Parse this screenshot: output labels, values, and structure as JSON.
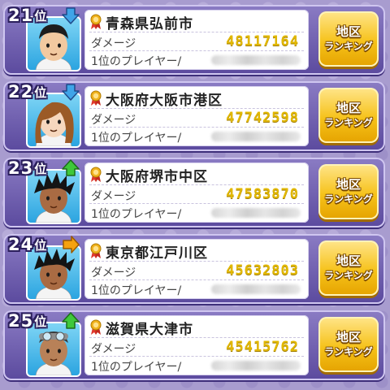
{
  "rank_suffix": "位",
  "damage_label": "ダメージ",
  "player_label": "1位のプレイヤー/",
  "button": {
    "line1": "地区",
    "line2": "ランキング"
  },
  "trend_colors": {
    "down": "#3fa4e8",
    "up": "#3ec83a",
    "flat": "#f5a20f"
  },
  "rows": [
    {
      "rank": "21",
      "trend": "down",
      "region": "青森県弘前市",
      "damage": "48117164",
      "avatar": "boy-short-hair",
      "skin": "#f2c9a0",
      "hair": "#1d1d1d",
      "bg": "blue"
    },
    {
      "rank": "22",
      "trend": "down",
      "region": "大阪府大阪市港区",
      "damage": "47742598",
      "avatar": "girl-brown-hair",
      "skin": "#f6d7bd",
      "hair": "#9b5a26",
      "bg": "blue"
    },
    {
      "rank": "23",
      "trend": "up",
      "region": "大阪府堺市中区",
      "damage": "47583870",
      "avatar": "boy-spiky-hair",
      "skin": "#a96b43",
      "hair": "#141414",
      "bg": "blue"
    },
    {
      "rank": "24",
      "trend": "flat",
      "region": "東京都江戸川区",
      "damage": "45632803",
      "avatar": "boy-spiky-hair",
      "skin": "#a96b43",
      "hair": "#141414",
      "bg": "blue"
    },
    {
      "rank": "25",
      "trend": "up",
      "region": "滋賀県大津市",
      "damage": "45415762",
      "avatar": "man-goggles",
      "skin": "#b88158",
      "hair": "#3a3a3a",
      "bg": "blue"
    }
  ]
}
